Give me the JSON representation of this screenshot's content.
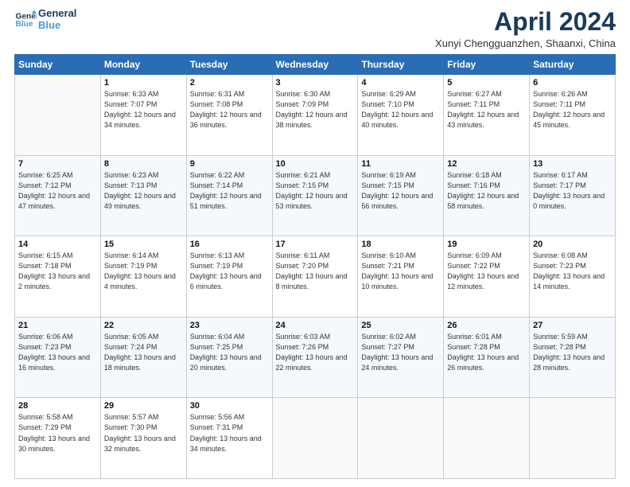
{
  "logo": {
    "line1": "General",
    "line2": "Blue"
  },
  "title": "April 2024",
  "location": "Xunyi Chengguanzhen, Shaanxi, China",
  "days_of_week": [
    "Sunday",
    "Monday",
    "Tuesday",
    "Wednesday",
    "Thursday",
    "Friday",
    "Saturday"
  ],
  "weeks": [
    [
      {
        "day": null,
        "info": null
      },
      {
        "day": "1",
        "sunrise": "6:33 AM",
        "sunset": "7:07 PM",
        "daylight": "12 hours and 34 minutes."
      },
      {
        "day": "2",
        "sunrise": "6:31 AM",
        "sunset": "7:08 PM",
        "daylight": "12 hours and 36 minutes."
      },
      {
        "day": "3",
        "sunrise": "6:30 AM",
        "sunset": "7:09 PM",
        "daylight": "12 hours and 38 minutes."
      },
      {
        "day": "4",
        "sunrise": "6:29 AM",
        "sunset": "7:10 PM",
        "daylight": "12 hours and 40 minutes."
      },
      {
        "day": "5",
        "sunrise": "6:27 AM",
        "sunset": "7:11 PM",
        "daylight": "12 hours and 43 minutes."
      },
      {
        "day": "6",
        "sunrise": "6:26 AM",
        "sunset": "7:11 PM",
        "daylight": "12 hours and 45 minutes."
      }
    ],
    [
      {
        "day": "7",
        "sunrise": "6:25 AM",
        "sunset": "7:12 PM",
        "daylight": "12 hours and 47 minutes."
      },
      {
        "day": "8",
        "sunrise": "6:23 AM",
        "sunset": "7:13 PM",
        "daylight": "12 hours and 49 minutes."
      },
      {
        "day": "9",
        "sunrise": "6:22 AM",
        "sunset": "7:14 PM",
        "daylight": "12 hours and 51 minutes."
      },
      {
        "day": "10",
        "sunrise": "6:21 AM",
        "sunset": "7:15 PM",
        "daylight": "12 hours and 53 minutes."
      },
      {
        "day": "11",
        "sunrise": "6:19 AM",
        "sunset": "7:15 PM",
        "daylight": "12 hours and 56 minutes."
      },
      {
        "day": "12",
        "sunrise": "6:18 AM",
        "sunset": "7:16 PM",
        "daylight": "12 hours and 58 minutes."
      },
      {
        "day": "13",
        "sunrise": "6:17 AM",
        "sunset": "7:17 PM",
        "daylight": "13 hours and 0 minutes."
      }
    ],
    [
      {
        "day": "14",
        "sunrise": "6:15 AM",
        "sunset": "7:18 PM",
        "daylight": "13 hours and 2 minutes."
      },
      {
        "day": "15",
        "sunrise": "6:14 AM",
        "sunset": "7:19 PM",
        "daylight": "13 hours and 4 minutes."
      },
      {
        "day": "16",
        "sunrise": "6:13 AM",
        "sunset": "7:19 PM",
        "daylight": "13 hours and 6 minutes."
      },
      {
        "day": "17",
        "sunrise": "6:11 AM",
        "sunset": "7:20 PM",
        "daylight": "13 hours and 8 minutes."
      },
      {
        "day": "18",
        "sunrise": "6:10 AM",
        "sunset": "7:21 PM",
        "daylight": "13 hours and 10 minutes."
      },
      {
        "day": "19",
        "sunrise": "6:09 AM",
        "sunset": "7:22 PM",
        "daylight": "13 hours and 12 minutes."
      },
      {
        "day": "20",
        "sunrise": "6:08 AM",
        "sunset": "7:23 PM",
        "daylight": "13 hours and 14 minutes."
      }
    ],
    [
      {
        "day": "21",
        "sunrise": "6:06 AM",
        "sunset": "7:23 PM",
        "daylight": "13 hours and 16 minutes."
      },
      {
        "day": "22",
        "sunrise": "6:05 AM",
        "sunset": "7:24 PM",
        "daylight": "13 hours and 18 minutes."
      },
      {
        "day": "23",
        "sunrise": "6:04 AM",
        "sunset": "7:25 PM",
        "daylight": "13 hours and 20 minutes."
      },
      {
        "day": "24",
        "sunrise": "6:03 AM",
        "sunset": "7:26 PM",
        "daylight": "13 hours and 22 minutes."
      },
      {
        "day": "25",
        "sunrise": "6:02 AM",
        "sunset": "7:27 PM",
        "daylight": "13 hours and 24 minutes."
      },
      {
        "day": "26",
        "sunrise": "6:01 AM",
        "sunset": "7:28 PM",
        "daylight": "13 hours and 26 minutes."
      },
      {
        "day": "27",
        "sunrise": "5:59 AM",
        "sunset": "7:28 PM",
        "daylight": "13 hours and 28 minutes."
      }
    ],
    [
      {
        "day": "28",
        "sunrise": "5:58 AM",
        "sunset": "7:29 PM",
        "daylight": "13 hours and 30 minutes."
      },
      {
        "day": "29",
        "sunrise": "5:57 AM",
        "sunset": "7:30 PM",
        "daylight": "13 hours and 32 minutes."
      },
      {
        "day": "30",
        "sunrise": "5:56 AM",
        "sunset": "7:31 PM",
        "daylight": "13 hours and 34 minutes."
      },
      {
        "day": null,
        "info": null
      },
      {
        "day": null,
        "info": null
      },
      {
        "day": null,
        "info": null
      },
      {
        "day": null,
        "info": null
      }
    ]
  ],
  "labels": {
    "sunrise": "Sunrise:",
    "sunset": "Sunset:",
    "daylight": "Daylight:"
  }
}
